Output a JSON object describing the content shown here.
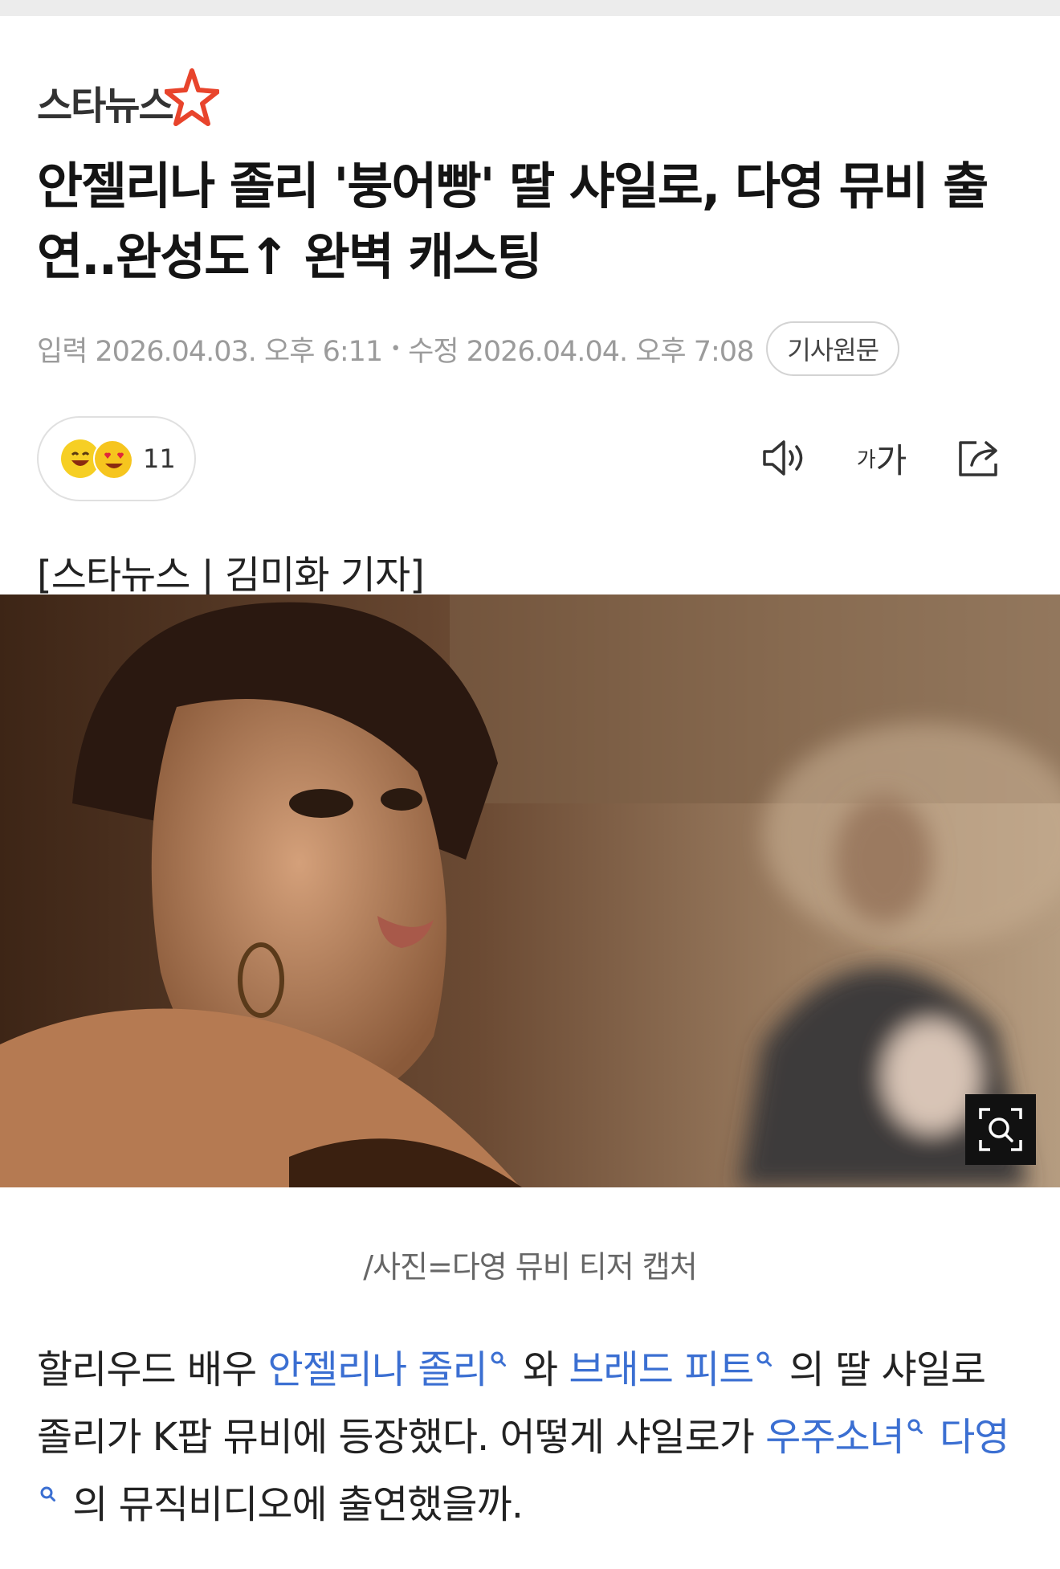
{
  "article": {
    "logo_text": "스타뉴스",
    "headline": "안젤리나 졸리 '붕어빵' 딸 샤일로, 다영 뮤비 출연..완성도↑ 완벽 캐스팅",
    "meta": {
      "input_label": "입력",
      "input_time": "2026.04.03. 오후 6:11",
      "edit_label": "수정",
      "edit_time": "2026.04.04. 오후 7:08",
      "original_button": "기사원문"
    },
    "reaction_count": "11",
    "font_size_label_small": "가",
    "font_size_label_large": "가",
    "byline": "[스타뉴스 | 김미화 기자]",
    "photo_caption": "/사진=다영 뮤비 티저 캡처",
    "body": {
      "p1_a": "할리우드 배우 ",
      "p1_link1": "안젤리나 졸리",
      "p1_b": " 와 ",
      "p1_link2": "브래드 피트",
      "p1_c": " 의 딸 샤일로 졸리가 K팝 뮤비에 등장했다. 어떻게 샤일로가 ",
      "p1_link3": "우주소녀",
      "p1_link4": "다영",
      "p1_d": " 의 뮤직비디오에 출연했을까."
    }
  },
  "icons": [
    "star-logo-icon",
    "laugh-emoji-icon",
    "heart-eyes-emoji-icon",
    "speaker-icon",
    "font-size-icon",
    "share-icon",
    "zoom-icon",
    "search-link-icon"
  ],
  "colors": {
    "link": "#3b6fd2",
    "logo_star": "#e8442c",
    "emoji": "#f6cf24"
  }
}
